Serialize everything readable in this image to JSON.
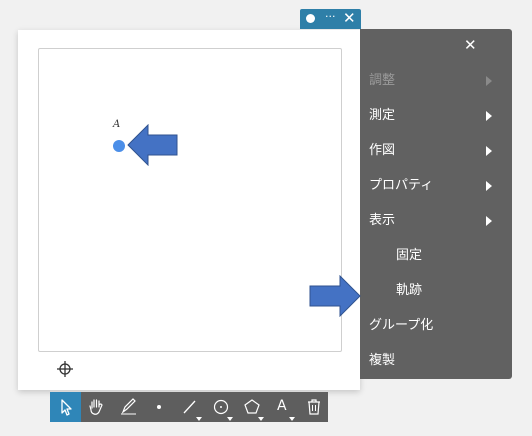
{
  "canvas": {
    "point_label": "A"
  },
  "window_bar": {
    "dots": "···",
    "close": "✕"
  },
  "menu": {
    "close": "✕",
    "items": [
      {
        "label": "調整",
        "disabled": true,
        "has_submenu": true
      },
      {
        "label": "測定",
        "has_submenu": true
      },
      {
        "label": "作図",
        "has_submenu": true
      },
      {
        "label": "プロパティ",
        "has_submenu": true
      },
      {
        "label": "表示",
        "has_submenu": true
      },
      {
        "label": "固定",
        "indent": true
      },
      {
        "label": "軌跡",
        "indent": true
      },
      {
        "label": "グループ化"
      },
      {
        "label": "複製"
      }
    ]
  },
  "toolbar": {
    "tools": [
      "select-tool",
      "hand-tool",
      "pen-tool",
      "point-tool",
      "line-tool",
      "circle-tool",
      "polygon-tool",
      "text-tool",
      "delete-tool"
    ],
    "text_tool_label": "A",
    "active": "select-tool"
  },
  "colors": {
    "accent": "#2f86b8",
    "point": "#4b8ee8",
    "arrow": "#4472c4",
    "menu_bg": "#616161",
    "toolbar_bg": "#5e5e5e"
  }
}
